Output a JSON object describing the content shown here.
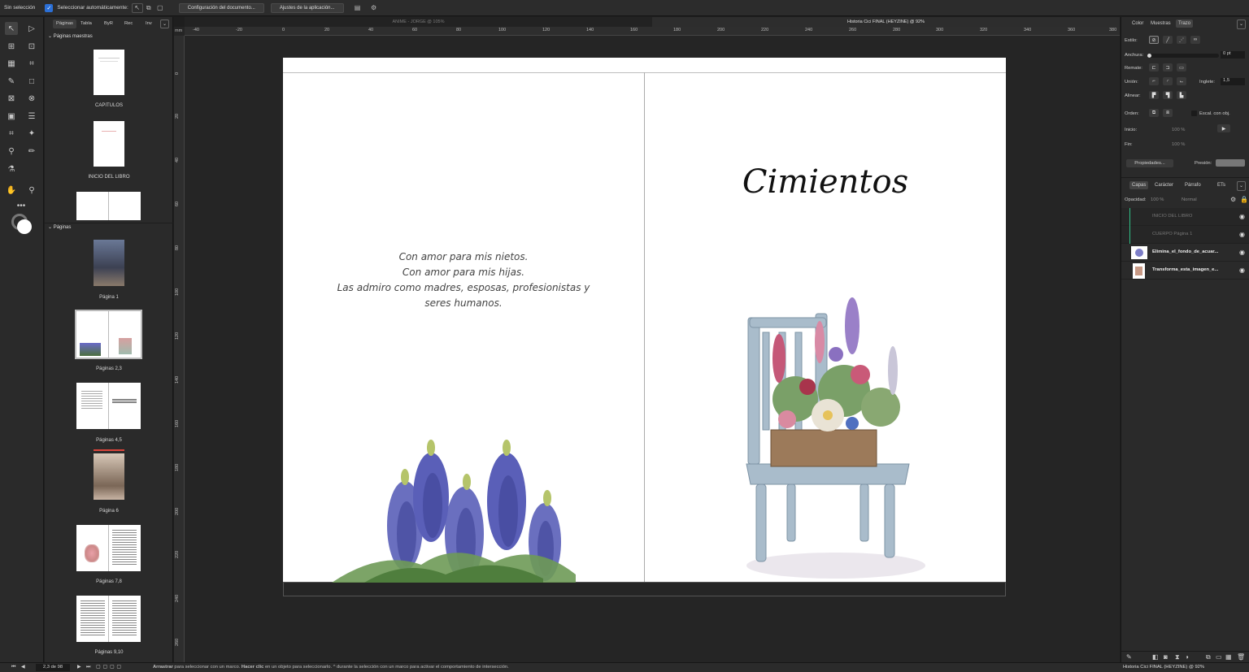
{
  "topbar": {
    "no_selection": "Sin selección",
    "auto_select_label": "Seleccionar automáticamente:",
    "doc_setup_button": "Configuración del documento...",
    "app_settings_button": "Ajustes de la aplicación..."
  },
  "doc_tabs": {
    "tab1": "ANIME - JORGE @ 105%",
    "tab2": "Historia Cici FINAL (HEYZINE) @ 92%"
  },
  "pages_panel": {
    "tabs": [
      "Páginas",
      "Tabla",
      "ByR",
      "Rec",
      "Inv"
    ],
    "masters_header": "Páginas maestras",
    "masters": [
      "CAPITULOS",
      "INICIO DEL LIBRO"
    ],
    "pages_header": "Páginas",
    "pages": [
      "Página 1",
      "Páginas 2,3",
      "Páginas 4,5",
      "Página 6",
      "Páginas 7,8",
      "Páginas 9,10"
    ]
  },
  "ruler": {
    "unit": "mm",
    "top_ticks": [
      "-40",
      "-20",
      "0",
      "20",
      "40",
      "60",
      "80",
      "100",
      "120",
      "140",
      "160",
      "180",
      "200",
      "220",
      "240",
      "260",
      "280",
      "300",
      "320",
      "340",
      "360",
      "380"
    ],
    "left_ticks": [
      "0",
      "20",
      "40",
      "60",
      "80",
      "100",
      "120",
      "140",
      "160",
      "180",
      "200",
      "220",
      "240",
      "260"
    ]
  },
  "spread": {
    "dedication_lines": [
      "Con amor para mis nietos.",
      "Con amor para mis hijas.",
      "Las admiro como madres, esposas, profesionistas y",
      "seres humanos."
    ],
    "title": "Cimientos"
  },
  "stroke_panel": {
    "tabs": [
      "Color",
      "Muestras",
      "Trazo"
    ],
    "style_label": "Estilo:",
    "width_label": "Anchura:",
    "width_value": "0 pt",
    "cap_label": "Remate:",
    "join_label": "Unión:",
    "miter_label": "Inglete:",
    "miter_value": "1,5",
    "align_label": "Alinear:",
    "order_label": "Orden:",
    "scale_label": "Escal. con obj.",
    "start_label": "Inicio:",
    "end_label": "Fin:",
    "pct_start": "100 %",
    "pct_end": "100 %",
    "properties_button": "Propiedades...",
    "pressure_label": "Presión:"
  },
  "layers_panel": {
    "tabs": [
      "Capas",
      "Carácter",
      "Párrafo",
      "ETs"
    ],
    "opacity_label": "Opacidad:",
    "opacity_value": "100 %",
    "blend_value": "Normal",
    "layers": [
      "INICIO DEL LIBRO",
      "CUERPO Página 1",
      "Elimina_el_fondo_de_acuar...",
      "Transforma_esta_imagen_e..."
    ]
  },
  "status": {
    "page_indicator": "2,3 de 98",
    "hint_bold1": "Arrastrar",
    "hint1": " para seleccionar con un marco. ",
    "hint_bold2": "Hacer clic",
    "hint2": " en un objeto para seleccionarlo. ^ durante la selección con un marco para activar el comportamiento de intersección.",
    "doc_title": "Historia Cici FINAL (HEYZINE) @ 92%"
  },
  "colors": {
    "accent": "#2b6fd6",
    "panel": "#2a2a2a",
    "canvas": "#252525"
  }
}
